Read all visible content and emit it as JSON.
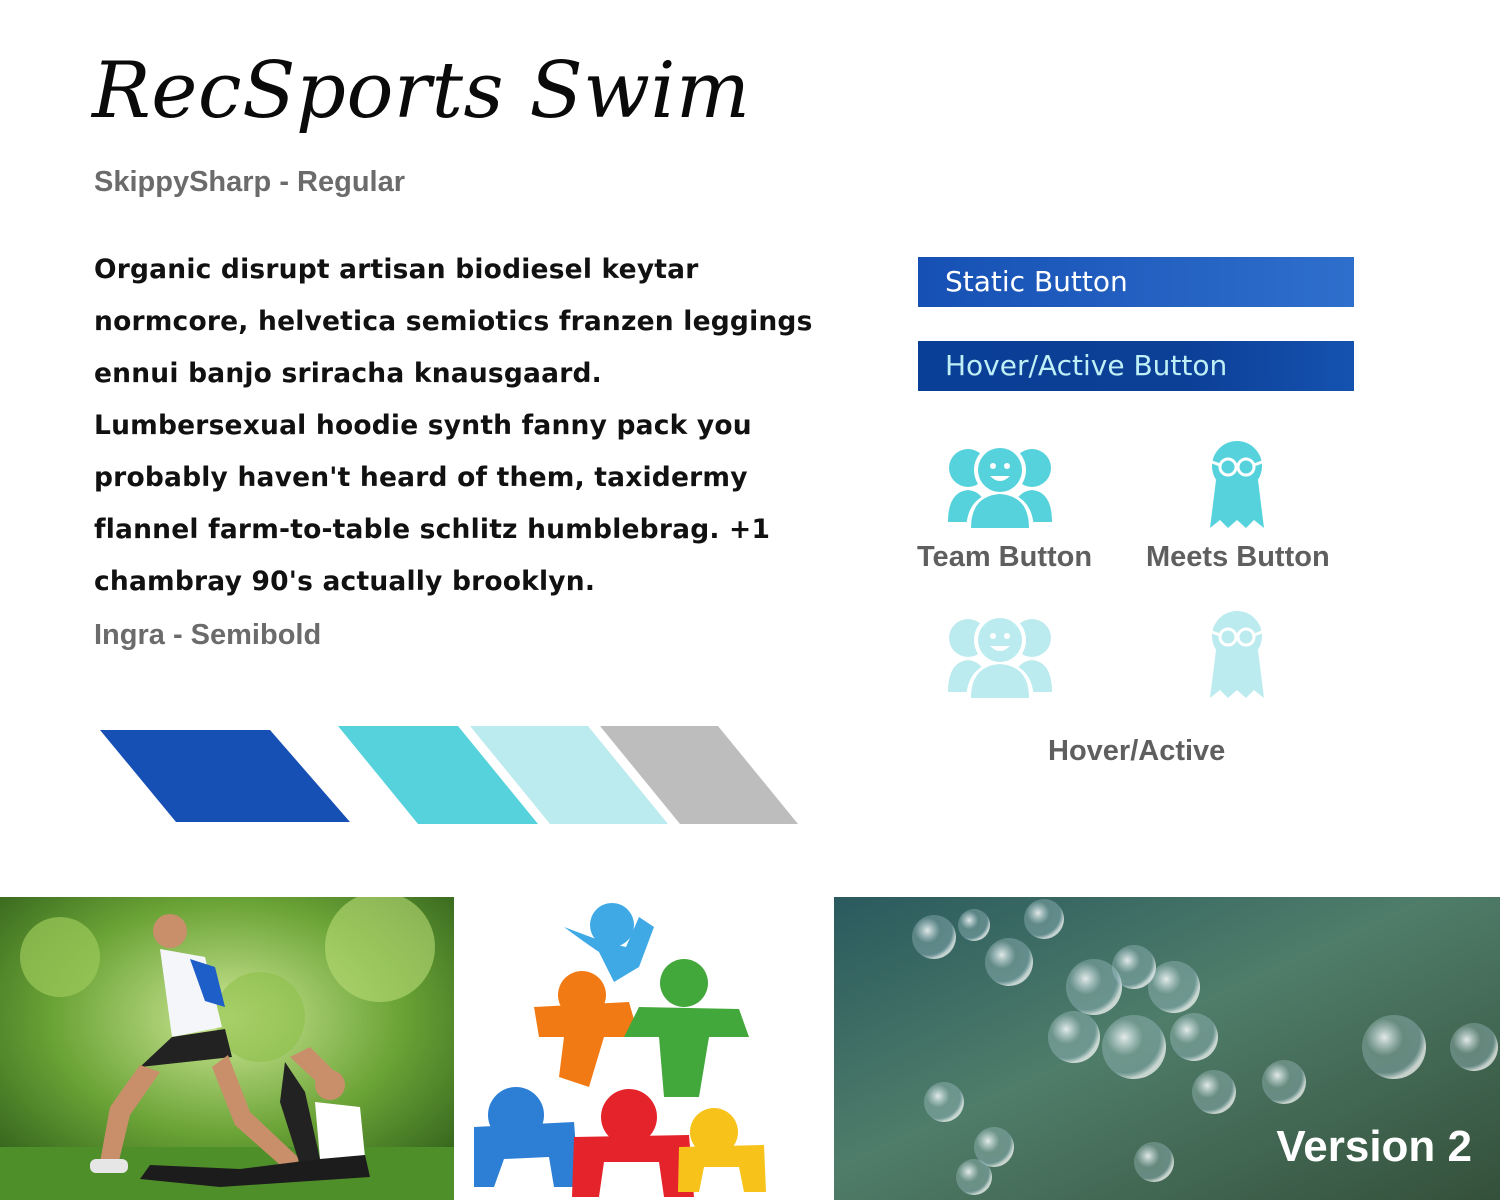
{
  "brand": {
    "title": "RecSports Swim",
    "title_font_label": "SkippySharp - Regular"
  },
  "body": {
    "copy": "Organic disrupt artisan biodiesel keytar normcore, helvetica semiotics franzen leggings ennui banjo sriracha knausgaard. Lumbersexual hoodie synth fanny pack you probably haven't heard of them, taxidermy flannel farm-to-table schlitz humblebrag. +1 chambray 90's actually brooklyn.",
    "font_label": "Ingra - Semibold"
  },
  "buttons": {
    "static_label": "Static Button",
    "hover_label": "Hover/Active Button"
  },
  "icons": {
    "team_label": "Team Button",
    "meets_label": "Meets Button",
    "hover_caption": "Hover/Active"
  },
  "palette": {
    "colors": [
      "#1650b4",
      "#56d2dc",
      "#bcebef",
      "#bdbdbd"
    ]
  },
  "photos": {
    "version_label": "Version 2"
  }
}
